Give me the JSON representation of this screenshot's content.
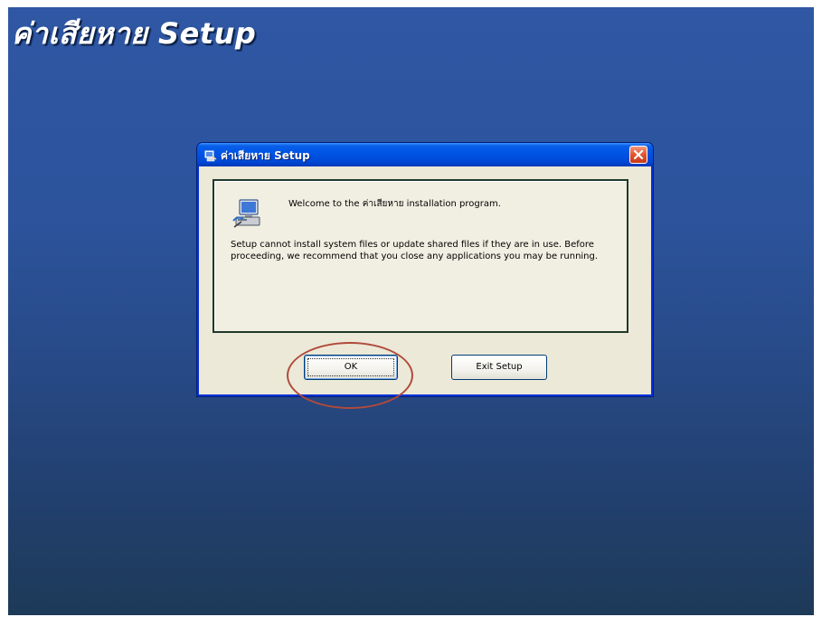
{
  "screen": {
    "background_title": "ค่าเสียหาย Setup"
  },
  "dialog": {
    "title": "ค่าเสียหาย Setup",
    "icons": {
      "title_icon": "setup-computer-icon",
      "close_icon": "close-x-icon",
      "body_icon": "setup-computer-icon"
    },
    "welcome": "Welcome to the ค่าเสียหาย installation program.",
    "warning": "Setup cannot install system files or update shared files if they are in use. Before proceeding, we recommend that you close any applications you may be running.",
    "buttons": {
      "ok": "OK",
      "exit": "Exit Setup"
    }
  },
  "annotation": {
    "highlight_color": "#b04a3c",
    "highlights": "ok-button"
  },
  "colors": {
    "desktop": "#2c539c",
    "titlebar": "#0055e5",
    "dialog_face": "#ece9d8",
    "close_button": "#e2532f"
  }
}
